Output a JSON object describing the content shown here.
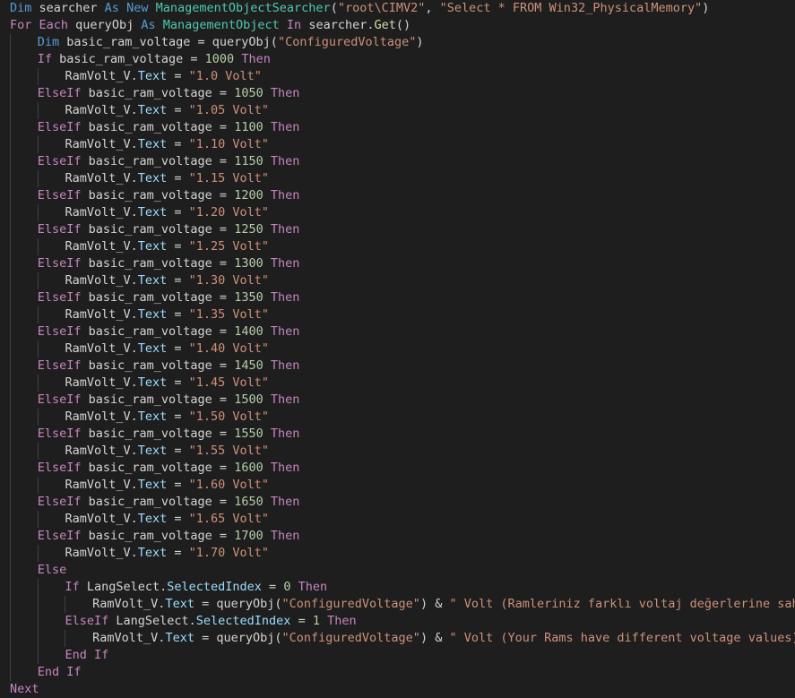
{
  "editor": {
    "language": "Visual Basic",
    "theme_colors": {
      "background": "#1e1e1e",
      "keyword": "#569cd6",
      "control": "#c586c0",
      "string": "#ce9178",
      "number": "#b5cea8",
      "type": "#4ec9b0",
      "function": "#dcdcaa",
      "variable": "#9cdcfe",
      "plain": "#d4d4d4",
      "indent_guide": "#404040"
    },
    "lines": [
      {
        "indent": 0,
        "tokens": [
          [
            "kw",
            "Dim"
          ],
          [
            "plain",
            " searcher "
          ],
          [
            "kw",
            "As"
          ],
          [
            "plain",
            " "
          ],
          [
            "kw",
            "New"
          ],
          [
            "plain",
            " "
          ],
          [
            "type",
            "ManagementObjectSearcher"
          ],
          [
            "plain",
            "("
          ],
          [
            "str",
            "\"root\\CIMV2\""
          ],
          [
            "plain",
            ", "
          ],
          [
            "str",
            "\"Select * FROM Win32_PhysicalMemory\""
          ],
          [
            "plain",
            ")"
          ]
        ]
      },
      {
        "indent": 0,
        "tokens": [
          [
            "ctl",
            "For"
          ],
          [
            "plain",
            " "
          ],
          [
            "ctl",
            "Each"
          ],
          [
            "plain",
            " queryObj "
          ],
          [
            "kw",
            "As"
          ],
          [
            "plain",
            " "
          ],
          [
            "type",
            "ManagementObject"
          ],
          [
            "plain",
            " "
          ],
          [
            "ctl",
            "In"
          ],
          [
            "plain",
            " searcher."
          ],
          [
            "fn",
            "Get"
          ],
          [
            "plain",
            "()"
          ]
        ]
      },
      {
        "indent": 1,
        "tokens": [
          [
            "kw",
            "Dim"
          ],
          [
            "plain",
            " basic_ram_voltage = queryObj("
          ],
          [
            "str",
            "\"ConfiguredVoltage\""
          ],
          [
            "plain",
            ")"
          ]
        ]
      },
      {
        "indent": 1,
        "tokens": [
          [
            "ctl",
            "If"
          ],
          [
            "plain",
            " basic_ram_voltage = "
          ],
          [
            "num",
            "1000"
          ],
          [
            "plain",
            " "
          ],
          [
            "ctl",
            "Then"
          ]
        ]
      },
      {
        "indent": 2,
        "tokens": [
          [
            "plain",
            "RamVolt_V."
          ],
          [
            "var",
            "Text"
          ],
          [
            "plain",
            " = "
          ],
          [
            "str",
            "\"1.0 Volt\""
          ]
        ]
      },
      {
        "indent": 1,
        "tokens": [
          [
            "ctl",
            "ElseIf"
          ],
          [
            "plain",
            " basic_ram_voltage = "
          ],
          [
            "num",
            "1050"
          ],
          [
            "plain",
            " "
          ],
          [
            "ctl",
            "Then"
          ]
        ]
      },
      {
        "indent": 2,
        "tokens": [
          [
            "plain",
            "RamVolt_V."
          ],
          [
            "var",
            "Text"
          ],
          [
            "plain",
            " = "
          ],
          [
            "str",
            "\"1.05 Volt\""
          ]
        ]
      },
      {
        "indent": 1,
        "tokens": [
          [
            "ctl",
            "ElseIf"
          ],
          [
            "plain",
            " basic_ram_voltage = "
          ],
          [
            "num",
            "1100"
          ],
          [
            "plain",
            " "
          ],
          [
            "ctl",
            "Then"
          ]
        ]
      },
      {
        "indent": 2,
        "tokens": [
          [
            "plain",
            "RamVolt_V."
          ],
          [
            "var",
            "Text"
          ],
          [
            "plain",
            " = "
          ],
          [
            "str",
            "\"1.10 Volt\""
          ]
        ]
      },
      {
        "indent": 1,
        "tokens": [
          [
            "ctl",
            "ElseIf"
          ],
          [
            "plain",
            " basic_ram_voltage = "
          ],
          [
            "num",
            "1150"
          ],
          [
            "plain",
            " "
          ],
          [
            "ctl",
            "Then"
          ]
        ]
      },
      {
        "indent": 2,
        "tokens": [
          [
            "plain",
            "RamVolt_V."
          ],
          [
            "var",
            "Text"
          ],
          [
            "plain",
            " = "
          ],
          [
            "str",
            "\"1.15 Volt\""
          ]
        ]
      },
      {
        "indent": 1,
        "tokens": [
          [
            "ctl",
            "ElseIf"
          ],
          [
            "plain",
            " basic_ram_voltage = "
          ],
          [
            "num",
            "1200"
          ],
          [
            "plain",
            " "
          ],
          [
            "ctl",
            "Then"
          ]
        ]
      },
      {
        "indent": 2,
        "tokens": [
          [
            "plain",
            "RamVolt_V."
          ],
          [
            "var",
            "Text"
          ],
          [
            "plain",
            " = "
          ],
          [
            "str",
            "\"1.20 Volt\""
          ]
        ]
      },
      {
        "indent": 1,
        "tokens": [
          [
            "ctl",
            "ElseIf"
          ],
          [
            "plain",
            " basic_ram_voltage = "
          ],
          [
            "num",
            "1250"
          ],
          [
            "plain",
            " "
          ],
          [
            "ctl",
            "Then"
          ]
        ]
      },
      {
        "indent": 2,
        "tokens": [
          [
            "plain",
            "RamVolt_V."
          ],
          [
            "var",
            "Text"
          ],
          [
            "plain",
            " = "
          ],
          [
            "str",
            "\"1.25 Volt\""
          ]
        ]
      },
      {
        "indent": 1,
        "tokens": [
          [
            "ctl",
            "ElseIf"
          ],
          [
            "plain",
            " basic_ram_voltage = "
          ],
          [
            "num",
            "1300"
          ],
          [
            "plain",
            " "
          ],
          [
            "ctl",
            "Then"
          ]
        ]
      },
      {
        "indent": 2,
        "tokens": [
          [
            "plain",
            "RamVolt_V."
          ],
          [
            "var",
            "Text"
          ],
          [
            "plain",
            " = "
          ],
          [
            "str",
            "\"1.30 Volt\""
          ]
        ]
      },
      {
        "indent": 1,
        "tokens": [
          [
            "ctl",
            "ElseIf"
          ],
          [
            "plain",
            " basic_ram_voltage = "
          ],
          [
            "num",
            "1350"
          ],
          [
            "plain",
            " "
          ],
          [
            "ctl",
            "Then"
          ]
        ]
      },
      {
        "indent": 2,
        "tokens": [
          [
            "plain",
            "RamVolt_V."
          ],
          [
            "var",
            "Text"
          ],
          [
            "plain",
            " = "
          ],
          [
            "str",
            "\"1.35 Volt\""
          ]
        ]
      },
      {
        "indent": 1,
        "tokens": [
          [
            "ctl",
            "ElseIf"
          ],
          [
            "plain",
            " basic_ram_voltage = "
          ],
          [
            "num",
            "1400"
          ],
          [
            "plain",
            " "
          ],
          [
            "ctl",
            "Then"
          ]
        ]
      },
      {
        "indent": 2,
        "tokens": [
          [
            "plain",
            "RamVolt_V."
          ],
          [
            "var",
            "Text"
          ],
          [
            "plain",
            " = "
          ],
          [
            "str",
            "\"1.40 Volt\""
          ]
        ]
      },
      {
        "indent": 1,
        "tokens": [
          [
            "ctl",
            "ElseIf"
          ],
          [
            "plain",
            " basic_ram_voltage = "
          ],
          [
            "num",
            "1450"
          ],
          [
            "plain",
            " "
          ],
          [
            "ctl",
            "Then"
          ]
        ]
      },
      {
        "indent": 2,
        "tokens": [
          [
            "plain",
            "RamVolt_V."
          ],
          [
            "var",
            "Text"
          ],
          [
            "plain",
            " = "
          ],
          [
            "str",
            "\"1.45 Volt\""
          ]
        ]
      },
      {
        "indent": 1,
        "tokens": [
          [
            "ctl",
            "ElseIf"
          ],
          [
            "plain",
            " basic_ram_voltage = "
          ],
          [
            "num",
            "1500"
          ],
          [
            "plain",
            " "
          ],
          [
            "ctl",
            "Then"
          ]
        ]
      },
      {
        "indent": 2,
        "tokens": [
          [
            "plain",
            "RamVolt_V."
          ],
          [
            "var",
            "Text"
          ],
          [
            "plain",
            " = "
          ],
          [
            "str",
            "\"1.50 Volt\""
          ]
        ]
      },
      {
        "indent": 1,
        "tokens": [
          [
            "ctl",
            "ElseIf"
          ],
          [
            "plain",
            " basic_ram_voltage = "
          ],
          [
            "num",
            "1550"
          ],
          [
            "plain",
            " "
          ],
          [
            "ctl",
            "Then"
          ]
        ]
      },
      {
        "indent": 2,
        "tokens": [
          [
            "plain",
            "RamVolt_V."
          ],
          [
            "var",
            "Text"
          ],
          [
            "plain",
            " = "
          ],
          [
            "str",
            "\"1.55 Volt\""
          ]
        ]
      },
      {
        "indent": 1,
        "tokens": [
          [
            "ctl",
            "ElseIf"
          ],
          [
            "plain",
            " basic_ram_voltage = "
          ],
          [
            "num",
            "1600"
          ],
          [
            "plain",
            " "
          ],
          [
            "ctl",
            "Then"
          ]
        ]
      },
      {
        "indent": 2,
        "tokens": [
          [
            "plain",
            "RamVolt_V."
          ],
          [
            "var",
            "Text"
          ],
          [
            "plain",
            " = "
          ],
          [
            "str",
            "\"1.60 Volt\""
          ]
        ]
      },
      {
        "indent": 1,
        "tokens": [
          [
            "ctl",
            "ElseIf"
          ],
          [
            "plain",
            " basic_ram_voltage = "
          ],
          [
            "num",
            "1650"
          ],
          [
            "plain",
            " "
          ],
          [
            "ctl",
            "Then"
          ]
        ]
      },
      {
        "indent": 2,
        "tokens": [
          [
            "plain",
            "RamVolt_V."
          ],
          [
            "var",
            "Text"
          ],
          [
            "plain",
            " = "
          ],
          [
            "str",
            "\"1.65 Volt\""
          ]
        ]
      },
      {
        "indent": 1,
        "tokens": [
          [
            "ctl",
            "ElseIf"
          ],
          [
            "plain",
            " basic_ram_voltage = "
          ],
          [
            "num",
            "1700"
          ],
          [
            "plain",
            " "
          ],
          [
            "ctl",
            "Then"
          ]
        ]
      },
      {
        "indent": 2,
        "tokens": [
          [
            "plain",
            "RamVolt_V."
          ],
          [
            "var",
            "Text"
          ],
          [
            "plain",
            " = "
          ],
          [
            "str",
            "\"1.70 Volt\""
          ]
        ]
      },
      {
        "indent": 1,
        "tokens": [
          [
            "ctl",
            "Else"
          ]
        ]
      },
      {
        "indent": 2,
        "tokens": [
          [
            "ctl",
            "If"
          ],
          [
            "plain",
            " LangSelect."
          ],
          [
            "var",
            "SelectedIndex"
          ],
          [
            "plain",
            " = "
          ],
          [
            "num",
            "0"
          ],
          [
            "plain",
            " "
          ],
          [
            "ctl",
            "Then"
          ]
        ]
      },
      {
        "indent": 3,
        "tokens": [
          [
            "plain",
            "RamVolt_V."
          ],
          [
            "var",
            "Text"
          ],
          [
            "plain",
            " = queryObj("
          ],
          [
            "str",
            "\"ConfiguredVoltage\""
          ],
          [
            "plain",
            ") & "
          ],
          [
            "str",
            "\" Volt (Ramleriniz farklı voltaj değerlerine sahip)\""
          ]
        ]
      },
      {
        "indent": 2,
        "tokens": [
          [
            "ctl",
            "ElseIf"
          ],
          [
            "plain",
            " LangSelect."
          ],
          [
            "var",
            "SelectedIndex"
          ],
          [
            "plain",
            " = "
          ],
          [
            "num",
            "1"
          ],
          [
            "plain",
            " "
          ],
          [
            "ctl",
            "Then"
          ]
        ]
      },
      {
        "indent": 3,
        "tokens": [
          [
            "plain",
            "RamVolt_V."
          ],
          [
            "var",
            "Text"
          ],
          [
            "plain",
            " = queryObj("
          ],
          [
            "str",
            "\"ConfiguredVoltage\""
          ],
          [
            "plain",
            ") & "
          ],
          [
            "str",
            "\" Volt (Your Rams have different voltage values)\""
          ]
        ]
      },
      {
        "indent": 2,
        "tokens": [
          [
            "ctl",
            "End"
          ],
          [
            "plain",
            " "
          ],
          [
            "ctl",
            "If"
          ]
        ]
      },
      {
        "indent": 1,
        "tokens": [
          [
            "ctl",
            "End"
          ],
          [
            "plain",
            " "
          ],
          [
            "ctl",
            "If"
          ]
        ]
      },
      {
        "indent": 0,
        "tokens": [
          [
            "ctl",
            "Next"
          ]
        ]
      }
    ]
  }
}
